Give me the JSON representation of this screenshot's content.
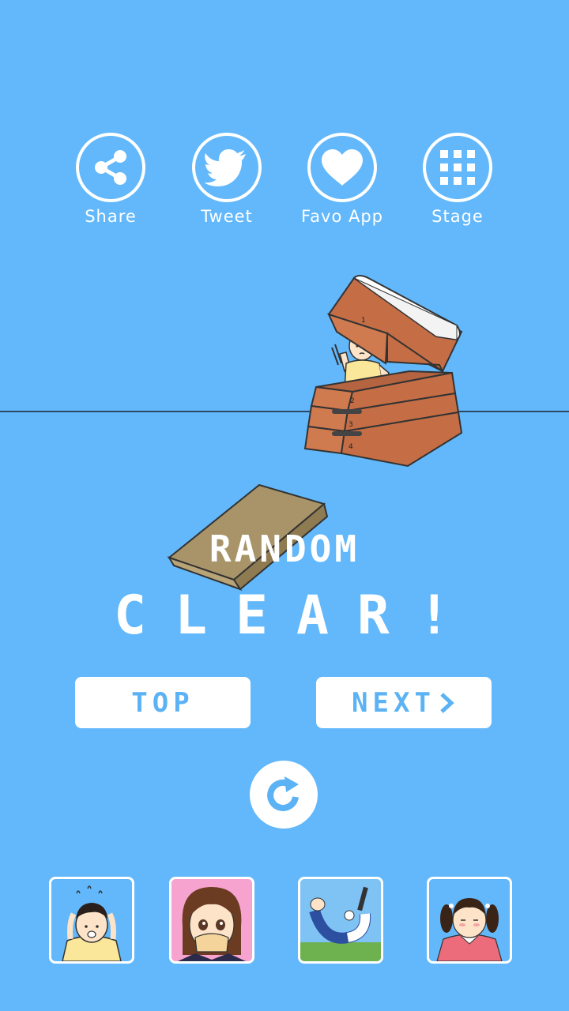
{
  "share_bar": {
    "items": [
      {
        "label": "Share",
        "icon": "share-icon"
      },
      {
        "label": "Tweet",
        "icon": "twitter-bird-icon"
      },
      {
        "label": "Favo App",
        "icon": "heart-icon"
      },
      {
        "label": "Stage",
        "icon": "grid-icon"
      }
    ]
  },
  "scene": {
    "box_numbers": [
      "1",
      "2",
      "3",
      "4"
    ]
  },
  "result": {
    "mode": "RANDOM",
    "status": "CLEAR!"
  },
  "nav": {
    "top_label": "TOP",
    "next_label": "NEXT",
    "next_icon": "chevron-right-icon",
    "retry_icon": "retry-icon"
  },
  "other_games": [
    {
      "icon": "boy-panic-thumbnail",
      "bg": "#62b8fb"
    },
    {
      "icon": "girl-toast-thumbnail",
      "bg": "#f7a3cf"
    },
    {
      "icon": "backbend-thumbnail",
      "bg": "#7fc3f5"
    },
    {
      "icon": "girl-pigtails-thumbnail",
      "bg": "#62b8fb"
    }
  ],
  "colors": {
    "background": "#62b8fb",
    "button_text": "#5bb2f4",
    "box_orange": "#c8704a",
    "springboard": "#a89468"
  }
}
